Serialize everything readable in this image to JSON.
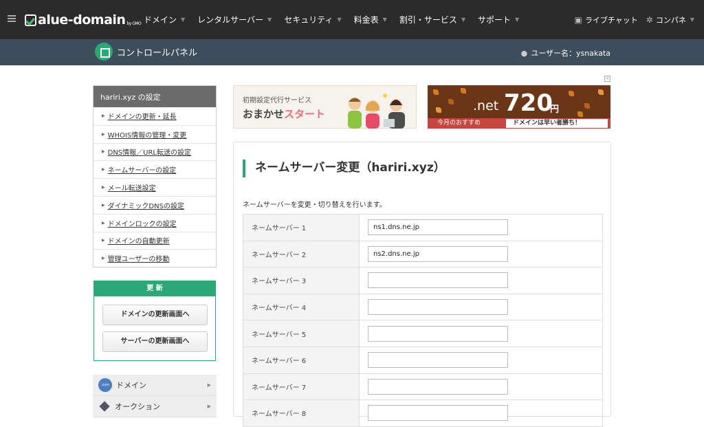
{
  "header": {
    "logo": "alue-domain",
    "logo_sub": "by GMO",
    "nav": [
      {
        "label": "ドメイン"
      },
      {
        "label": "レンタルサーバー"
      },
      {
        "label": "セキュリティ"
      },
      {
        "label": "料金表"
      },
      {
        "label": "割引・サービス"
      },
      {
        "label": "サポート"
      }
    ],
    "livechat": "ライブチャット",
    "config": "コンパネ"
  },
  "control_bar": {
    "title": "コントロールパネル",
    "user": "ユーザー名：ysnakata"
  },
  "sidebar": {
    "heading": "hariri.xyz の設定",
    "items": [
      {
        "label": "ドメインの更新・延長"
      },
      {
        "label": "WHOIS情報の管理・変更"
      },
      {
        "label": "DNS情報／URL転送の設定"
      },
      {
        "label": "ネームサーバーの設定"
      },
      {
        "label": "メール転送設定"
      },
      {
        "label": "ダイナミックDNSの設定"
      },
      {
        "label": "ドメインロックの設定"
      },
      {
        "label": "ドメインの自動更新"
      },
      {
        "label": "管理ユーザーの移動"
      }
    ],
    "renew_heading": "更 新",
    "renew_domain_button": "ドメインの更新画面へ",
    "renew_server_button": "サーバーの更新画面へ",
    "menu": [
      {
        "label": "ドメイン",
        "icon_text": ".com"
      },
      {
        "label": "オークション"
      }
    ]
  },
  "banners": {
    "left_small": "初期設定代行サービス",
    "left_big_a": "おまかせ",
    "left_big_b": "スタート",
    "right_net": ".net",
    "right_price": "720",
    "right_yen": "円",
    "right_strip_left": "今月のおすすめ",
    "right_strip_right": "ドメインは早い者勝ち！"
  },
  "main": {
    "title": "ネームサーバー変更（hariri.xyz）",
    "description": "ネームサーバーを変更・切り替えを行います。",
    "nameservers": [
      {
        "label": "ネームサーバー 1",
        "value": "ns1.dns.ne.jp"
      },
      {
        "label": "ネームサーバー 2",
        "value": "ns2.dns.ne.jp"
      },
      {
        "label": "ネームサーバー 3",
        "value": ""
      },
      {
        "label": "ネームサーバー 4",
        "value": ""
      },
      {
        "label": "ネームサーバー 5",
        "value": ""
      },
      {
        "label": "ネームサーバー 6",
        "value": ""
      },
      {
        "label": "ネームサーバー 7",
        "value": ""
      },
      {
        "label": "ネームサーバー 8",
        "value": ""
      }
    ]
  },
  "colors": {
    "accent": "#2aa876",
    "topbar": "#2b2b2b",
    "subbar": "#3d4d5c"
  }
}
